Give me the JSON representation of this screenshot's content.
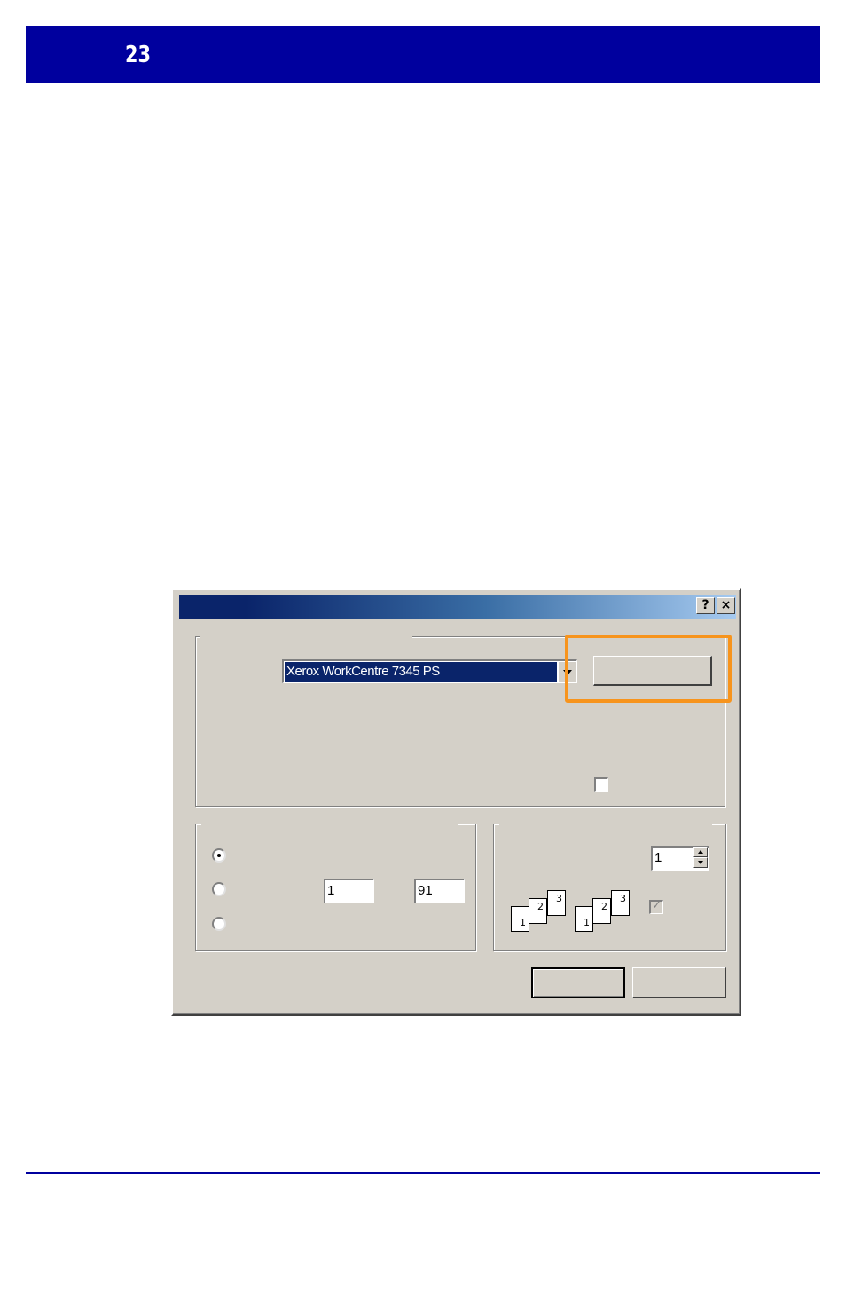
{
  "header": {
    "page_number": "23"
  },
  "dialog": {
    "titlebar_buttons": {
      "help_label": "?",
      "close_label": "×"
    },
    "printer": {
      "selected_name": "Xerox WorkCentre 7345 PS"
    },
    "page_range": {
      "from_value": "1",
      "to_value": "91"
    },
    "copies": {
      "count_value": "1",
      "collate_icons": [
        {
          "pages": [
            "1",
            "2",
            "3"
          ]
        },
        {
          "pages": [
            "1",
            "2",
            "3"
          ]
        }
      ]
    }
  },
  "highlight": {
    "color": "#f7941d"
  },
  "colors": {
    "header_blue": "#00009e",
    "dialog_face": "#d4d0c8",
    "selection": "#0a246a"
  }
}
